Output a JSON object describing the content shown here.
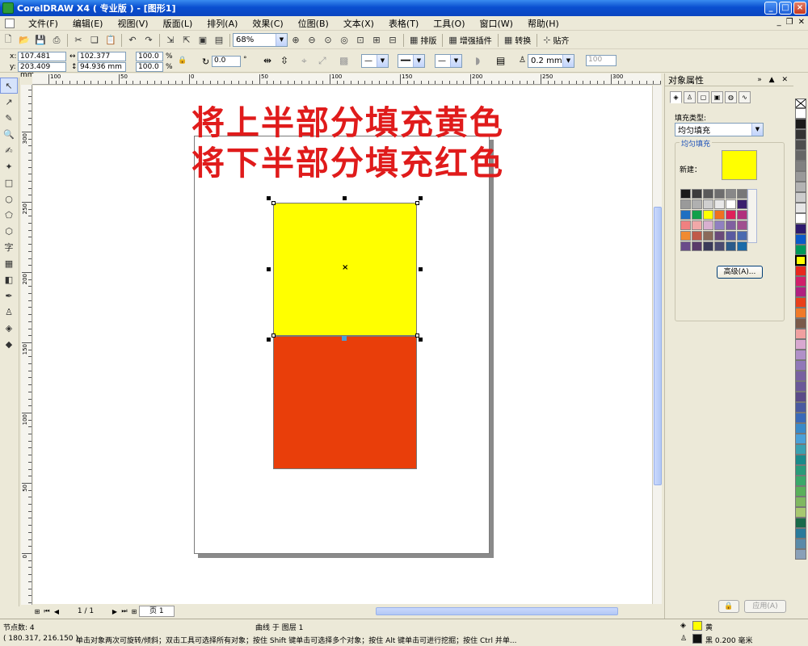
{
  "window": {
    "title": "CorelDRAW X4 ( 专业版 ) - [图形1]",
    "buttons": {
      "minimize": "_",
      "maximize": "□",
      "close": "×"
    }
  },
  "menu": [
    "文件(F)",
    "编辑(E)",
    "视图(V)",
    "版面(L)",
    "排列(A)",
    "效果(C)",
    "位图(B)",
    "文本(X)",
    "表格(T)",
    "工具(O)",
    "窗口(W)",
    "帮助(H)"
  ],
  "toolbar": {
    "zoom": "68%",
    "arrange_label": "排版",
    "plugin_label": "增强插件",
    "convert_label": "转换",
    "snap_label": "贴齐"
  },
  "propbar": {
    "x_label": "x:",
    "x": "107.481 mm",
    "y_label": "y:",
    "y": "203.409 mm",
    "w": "102.377 mm",
    "h": "94.936 mm",
    "scale_x": "100.0",
    "scale_y": "100.0",
    "pct": "%",
    "rotation": "0.0",
    "deg": "°",
    "outline_width": "0.2 mm",
    "dim_value": "100"
  },
  "ruler": {
    "h": [
      "100",
      "50",
      "0",
      "50",
      "100",
      "150",
      "200",
      "250",
      "300"
    ],
    "v": [
      "300",
      "250",
      "200",
      "150",
      "100",
      "50",
      "0"
    ],
    "h_unit": "毫米",
    "v_unit": "毫米"
  },
  "canvas": {
    "line1": "将上半部分填充黄色",
    "line2": "将下半部分填充红色",
    "colors": {
      "yellow": "#ffff00",
      "red": "#e93e0a",
      "banner": "#e01b1b"
    }
  },
  "pagenav": {
    "count": "1 / 1",
    "tab": "页 1"
  },
  "status": {
    "nodes": "节点数: 4",
    "object": "曲线 于 图层 1",
    "coords": "( 180.317, 216.150 )",
    "hint": "单击对象两次可旋转/倾斜；双击工具可选择所有对象；按住 Shift 键单击可选择多个对象；按住 Alt 键单击可进行挖掘；按住 Ctrl 并单...",
    "fill_name": "黄",
    "outline": "黑  0.200 毫米"
  },
  "docker": {
    "title": "对象属性",
    "fill_type_label": "填充类型:",
    "fill_type": "均匀填充",
    "group_title": "均匀填充",
    "new_label": "新建：",
    "advanced": "高级(A)...",
    "apply": "应用(A)"
  },
  "swatch_grid": [
    "#1a1a1a",
    "#3c3c3c",
    "#5a5a5a",
    "#6e6e6e",
    "#888888",
    "#777777",
    "#9a9a9a",
    "#b0b0b0",
    "#cfcfcf",
    "#e8e8e8",
    "#ffffff",
    "#3a1f6e",
    "#1e6fc2",
    "#10a04a",
    "#ffff00",
    "#f07020",
    "#e0205a",
    "#b0307e",
    "#f08080",
    "#f0a8a8",
    "#d8b0d0",
    "#9080c0",
    "#8060a0",
    "#a05090",
    "#f08a30",
    "#c05a4a",
    "#8a6a5a",
    "#6a4a7a",
    "#5a5aa0",
    "#4a6ab0",
    "#6a4a8a",
    "#5a3a6a",
    "#3a3a5a",
    "#4a4a70",
    "#2a5a8a",
    "#1a6aa8"
  ],
  "palette": [
    "#ffffff",
    "#1a1a1a",
    "#333333",
    "#4d4d4d",
    "#666666",
    "#808080",
    "#999999",
    "#b3b3b3",
    "#cccccc",
    "#e6e6e6",
    "#ffffff",
    "#2e1a6e",
    "#0a5ac8",
    "#00985a",
    "#ffff00",
    "#e8281e",
    "#d0206a",
    "#b02080",
    "#e8401a",
    "#f07a28",
    "#7a5a4a",
    "#f0a0a0",
    "#d8a8d0",
    "#b090c8",
    "#9078b8",
    "#7860a0",
    "#6a5898",
    "#5a4a88",
    "#4a5aa0",
    "#3a6ab8",
    "#3a8ac8",
    "#4aa0d8",
    "#3aa0b0",
    "#1a8a8a",
    "#2a9a7a",
    "#3aa86a",
    "#5ab05a",
    "#80b860",
    "#a8c870",
    "#1a6a4a",
    "#2a7a9a",
    "#5a8aa8",
    "#8aa0b8"
  ]
}
